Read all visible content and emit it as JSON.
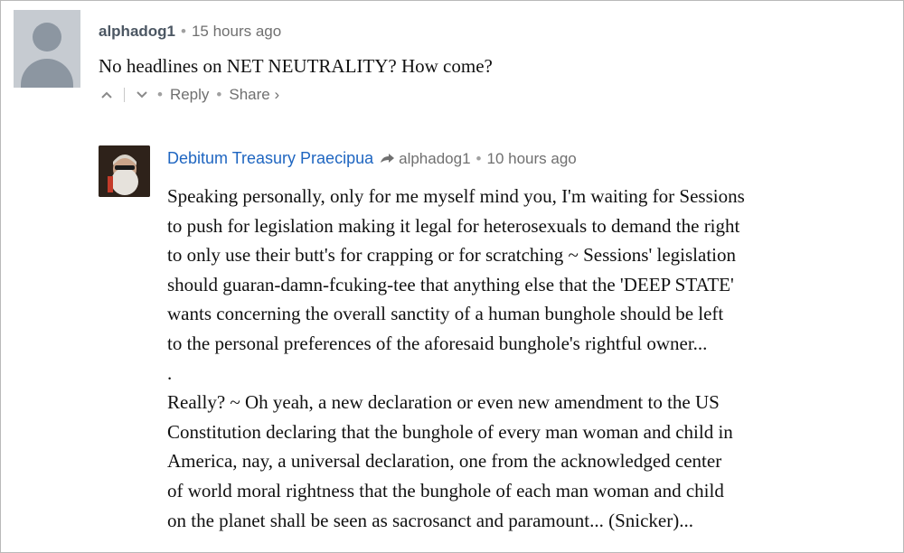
{
  "parent_comment": {
    "author": "alphadog1",
    "time": "15 hours ago",
    "text": "No headlines on NET NEUTRALITY? How come?",
    "actions": {
      "reply_label": "Reply",
      "share_label": "Share ›"
    }
  },
  "reply_comment": {
    "author": "Debitum Treasury Praecipua",
    "in_reply_to": "alphadog1",
    "time": "10 hours ago",
    "lines": [
      "Speaking personally, only for me myself mind you, I'm waiting for Sessions",
      "to push for legislation making it legal for heterosexuals to demand the right",
      "to only use their butt's for crapping or for scratching ~ Sessions' legislation",
      "should guaran-damn-fcuking-tee that anything else that the 'DEEP STATE'",
      "wants concerning the overall sanctity of a human bunghole should be left",
      "to the personal preferences of the aforesaid bunghole's rightful owner...",
      ".",
      "Really? ~ Oh yeah, a new declaration or even new amendment to the US",
      "Constitution declaring that the bunghole of every man woman and child in",
      "America, nay, a universal declaration, one from the acknowledged center",
      "of world moral rightness that the bunghole of each man woman and child",
      "on the planet shall be seen as sacrosanct and paramount... (Snicker)..."
    ]
  },
  "colors": {
    "author_link": "#1f66c1",
    "meta_gray": "#707070",
    "avatar_placeholder": "#c6cbd1"
  }
}
